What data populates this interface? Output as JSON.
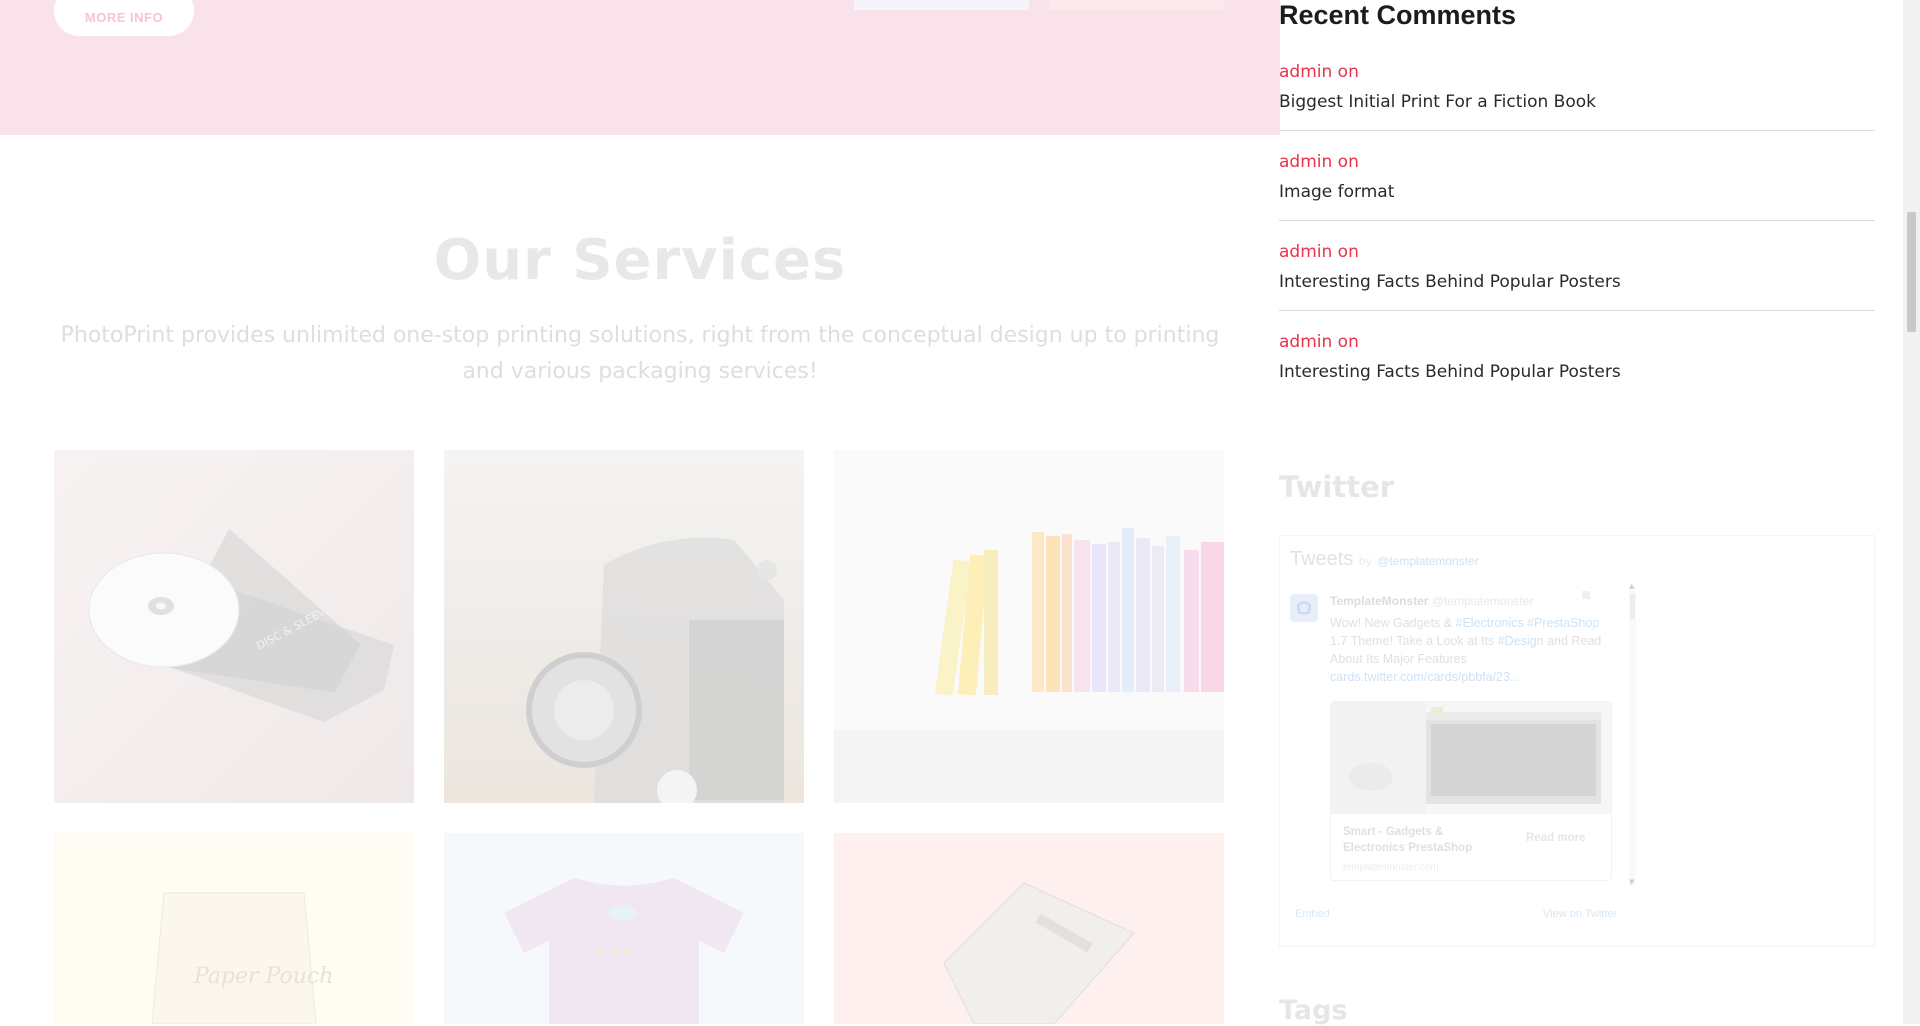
{
  "hero": {
    "more_info_label": "MORE INFO",
    "background": "#f9e2ea"
  },
  "services": {
    "title": "Our Services",
    "description": "PhotoPrint provides unlimited one-stop printing solutions, right from the conceptual design up to printing and various packaging services!",
    "tiles": [
      {
        "icon": "cd-packaging-image"
      },
      {
        "icon": "vintage-car-image"
      },
      {
        "icon": "books-image"
      },
      {
        "icon": "paper-pouch-image"
      },
      {
        "icon": "tshirt-image"
      },
      {
        "icon": "book-cover-image"
      }
    ],
    "cd_label": "DISC & SLEEVE",
    "pouch_label": "Paper Pouch"
  },
  "sidebar": {
    "recent_comments": {
      "title": "Recent Comments",
      "items": [
        {
          "author": "admin on",
          "post": "Biggest Initial Print For a Fiction Book"
        },
        {
          "author": "admin on",
          "post": "Image format"
        },
        {
          "author": "admin on",
          "post": "Interesting Facts Behind Popular Posters"
        },
        {
          "author": "admin on",
          "post": "Interesting Facts Behind Popular Posters"
        }
      ]
    },
    "twitter": {
      "title": "Twitter",
      "tweets_label": "Tweets",
      "by_label": "by",
      "handle": "@templatemonster",
      "account_name": "TemplateMonster",
      "account_handle": "@templatemonster",
      "tweet_text_1": "Wow! New Gadgets & ",
      "tag_electronics": "#Electronics",
      "tag_prestashop": "#PrestaShop",
      "tweet_text_2": " 1.7 Theme! Take a Look at Its ",
      "tag_design": "#Design",
      "tweet_text_3": " and Read About Its Major Features ",
      "tweet_link": "cards.twitter.com/cards/pbbfa/23...",
      "card_title": "Smart - Gadgets & Electronics PrestaShop",
      "card_domain": "templatemonster.com",
      "read_more": "Read more",
      "embed_label": "Embed",
      "view_on_twitter": "View on Twitter"
    },
    "tags": {
      "title": "Tags"
    }
  },
  "colors": {
    "accent": "#e8344a",
    "hero_pink": "#f9e2ea",
    "twitter_blue": "#3b94d9"
  }
}
